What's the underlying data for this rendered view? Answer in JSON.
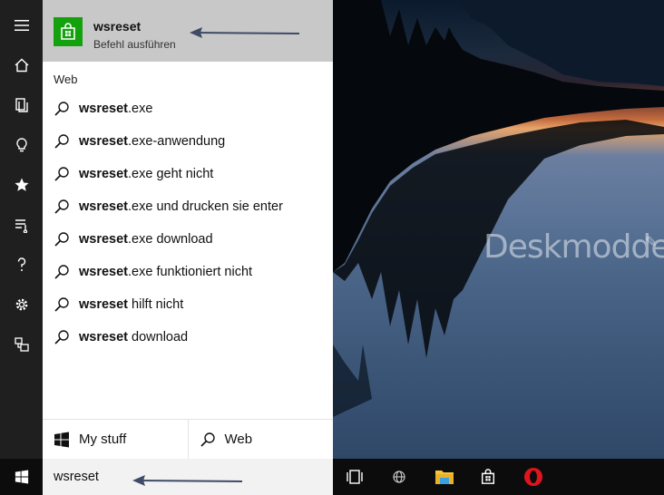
{
  "top_result": {
    "title": "wsreset",
    "subtitle": "Befehl ausführen"
  },
  "web_section": {
    "header": "Web",
    "suggestions": [
      {
        "bold": "wsreset",
        "rest": ".exe"
      },
      {
        "bold": "wsreset",
        "rest": ".exe-anwendung"
      },
      {
        "bold": "wsreset",
        "rest": ".exe geht nicht"
      },
      {
        "bold": "wsreset",
        "rest": ".exe und drucken sie enter"
      },
      {
        "bold": "wsreset",
        "rest": ".exe download"
      },
      {
        "bold": "wsreset",
        "rest": ".exe funktioniert nicht"
      },
      {
        "bold": "wsreset",
        "rest": " hilft nicht"
      },
      {
        "bold": "wsreset",
        "rest": " download"
      }
    ]
  },
  "bottom_tabs": {
    "my_stuff": "My stuff",
    "web": "Web"
  },
  "search": {
    "value": "wsreset"
  },
  "watermark": "Deskmodder.de",
  "colors": {
    "store_green": "#13a10e",
    "rail_bg": "#1f1f1f",
    "top_result_bg": "#c8c8c8",
    "taskbar_bg": "#0c0c0c",
    "opera_red": "#e0141e",
    "explorer_yellow": "#f5c43a"
  },
  "icons": {
    "rail": [
      "hamburger-icon",
      "home-icon",
      "notebook-icon",
      "lightbulb-icon",
      "star-icon",
      "music-list-icon",
      "help-icon",
      "gear-icon",
      "feedback-icon"
    ],
    "taskbar": [
      "windows-logo-icon",
      "task-view-icon",
      "globe-icon",
      "file-explorer-icon",
      "store-icon",
      "opera-icon"
    ]
  }
}
